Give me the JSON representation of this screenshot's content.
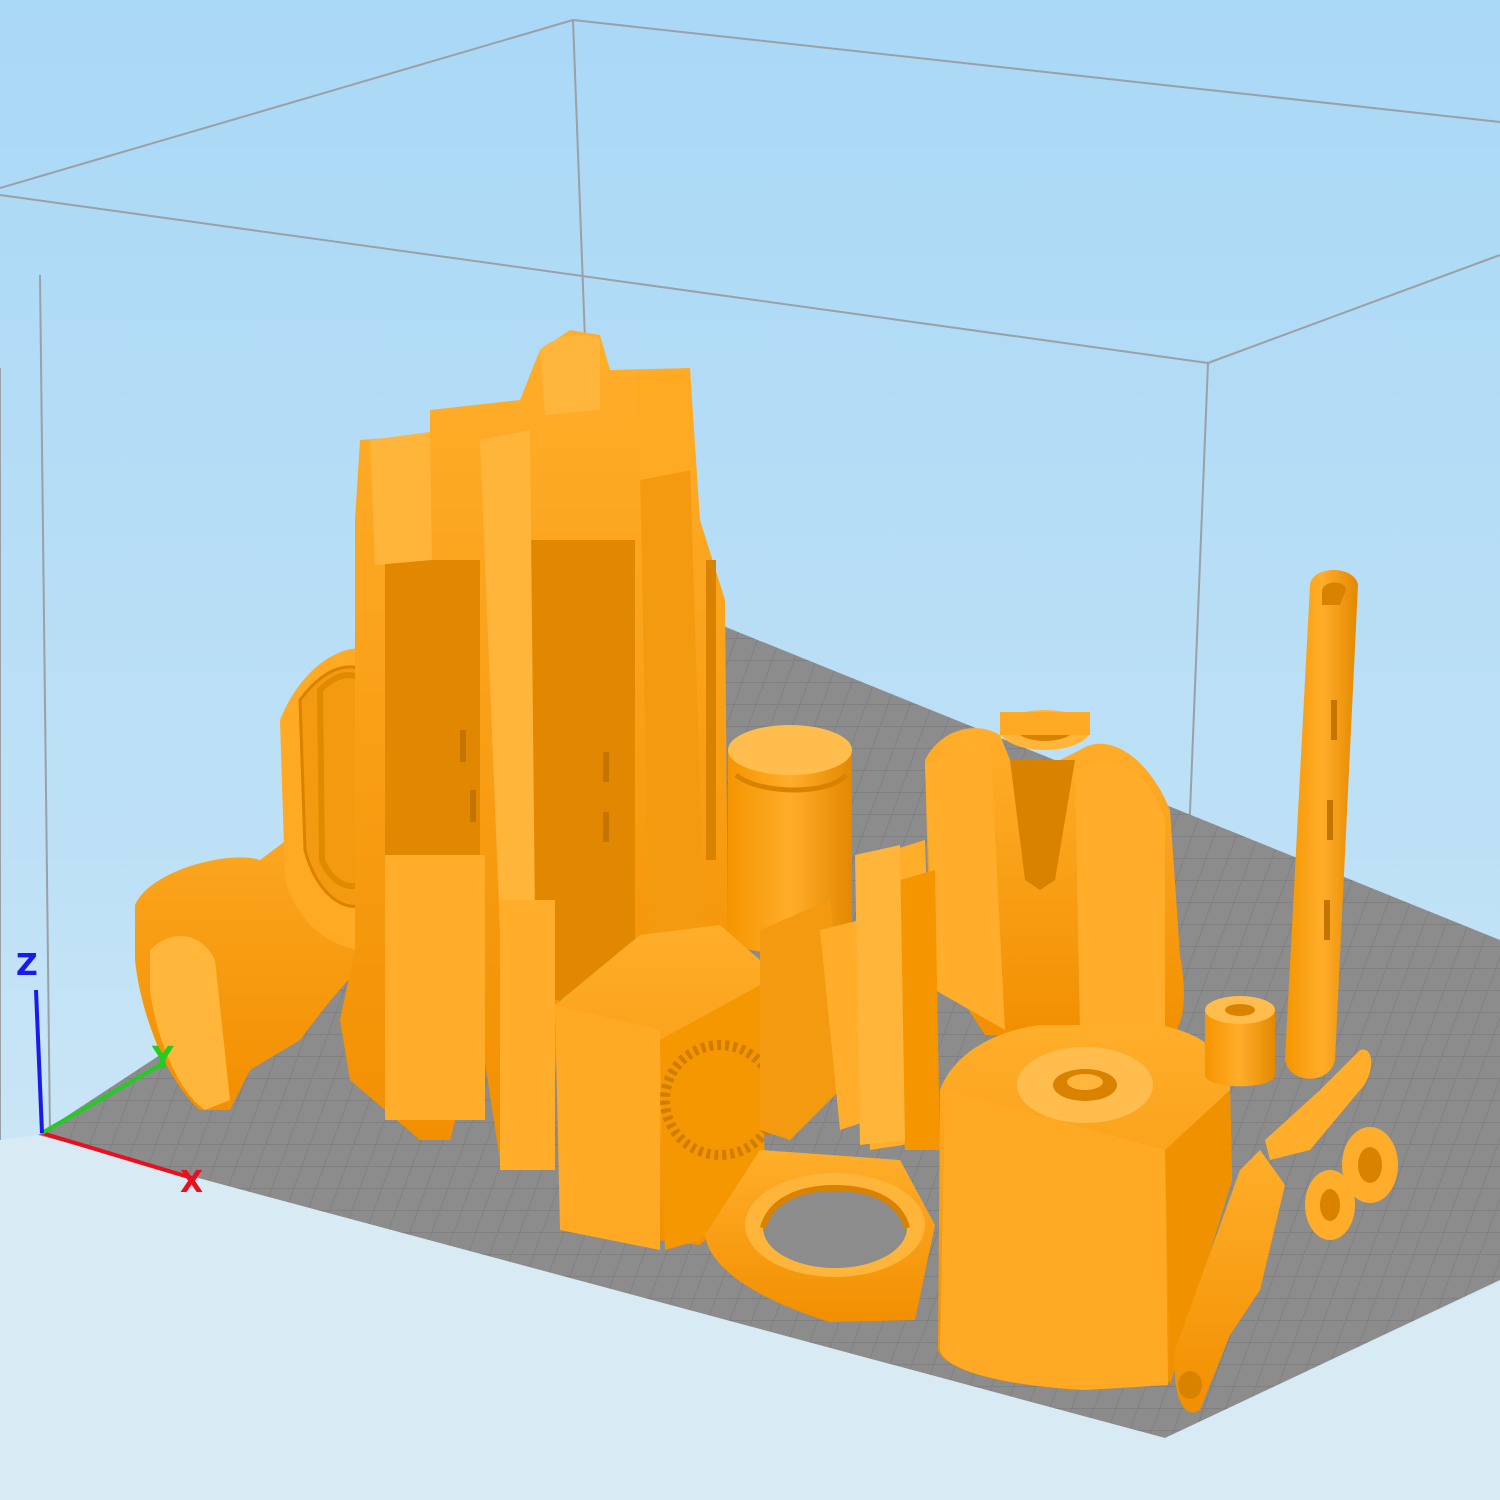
{
  "viewport": {
    "background_top": "#a9d8f6",
    "background_bottom": "#d9ecf6",
    "model_color": "#ffa31a",
    "model_shadow": "#e08400",
    "bed_color": "#8e8e8e",
    "grid_color": "#6c6c6c",
    "frame_color": "#9aa0a6"
  },
  "axes": {
    "x_label": "X",
    "y_label": "Y",
    "z_label": "Z",
    "x_color": "#e8101e",
    "y_color": "#22cc22",
    "z_color": "#1a1aee"
  },
  "objects": [
    "bellows-grip",
    "tall-receiver-halves",
    "cylindrical-cap",
    "ring-plate",
    "square-housing",
    "gear-block",
    "forked-mount",
    "link-arm",
    "small-spacer",
    "hook-lever",
    "wheels"
  ]
}
